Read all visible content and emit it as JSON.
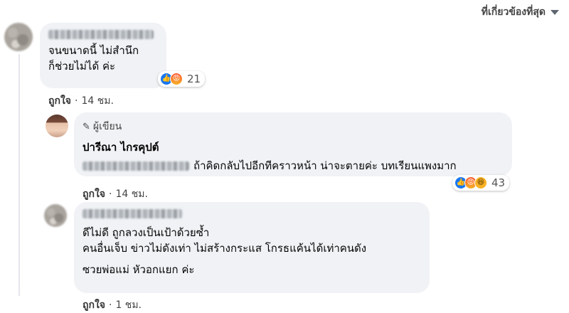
{
  "sort": {
    "label": "ที่เกี่ยวข้องที่สุด"
  },
  "comments": [
    {
      "text_lines": [
        "จนขนาดนี้ ไม่สำนึก",
        "ก็ช่วยไม่ได้ ค่ะ"
      ],
      "reaction_count": "21",
      "reactions": [
        "like-icon",
        "angry-icon"
      ],
      "like_label": "ถูกใจ",
      "time": "14 ชม."
    },
    {
      "author_badge": "ผู้เขียน",
      "author_name": "ปารีณา ไกรคุปต์",
      "text": "ถ้าคิดกลับไปอีกทีคราวหน้า น่าจะตายค่ะ บทเรียนแพงมาก",
      "reaction_count": "43",
      "reactions": [
        "like-icon",
        "angry-icon",
        "haha-icon"
      ],
      "like_label": "ถูกใจ",
      "time": "14 ชม."
    },
    {
      "text_lines": [
        "ดีไม่ดี ถูกลวงเป็นเป้าด้วยซ้ำ",
        "คนอื่นเจ็บ ข่าวไม่ดังเท่า ไม่สร้างกระแส โกรธแค้นได้เท่าคนดัง",
        "ซวยพ่อแม่ หัวอกแยก ค่ะ"
      ],
      "like_label": "ถูกใจ",
      "time": "1 ชม."
    }
  ],
  "colors": {
    "bubble": "#f0f2f5",
    "like": "#1877f2",
    "angry": "#f7714c"
  }
}
